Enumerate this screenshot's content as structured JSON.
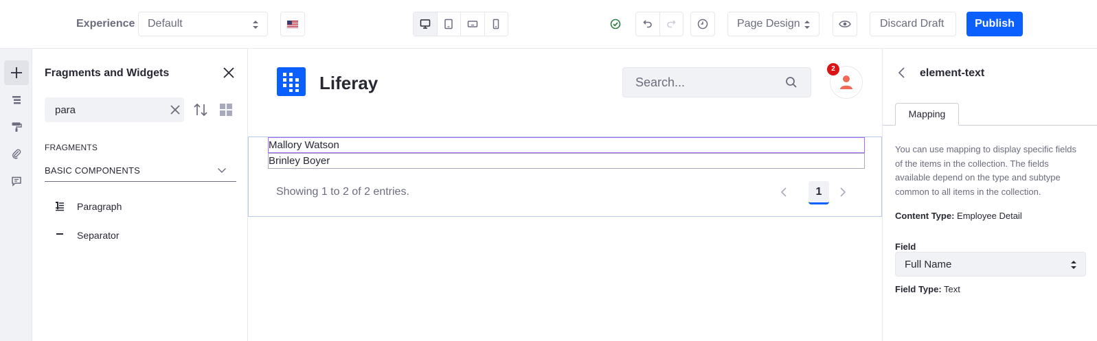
{
  "topbar": {
    "experience_label": "Experience",
    "experience_value": "Default",
    "language_flag": "us-flag-icon",
    "devices": [
      "desktop-icon",
      "tablet-icon",
      "landscape-phone-icon",
      "portrait-phone-icon"
    ],
    "view_mode": "Page Design",
    "discard_label": "Discard Draft",
    "publish_label": "Publish",
    "colors": {
      "primary": "#0b5fff",
      "success": "#287d3c"
    }
  },
  "rail": {
    "items": [
      "plus-icon",
      "page-structure-icon",
      "paint-roller-icon",
      "paperclip-icon",
      "comment-icon"
    ]
  },
  "left_panel": {
    "title": "Fragments and Widgets",
    "search_value": "para",
    "section_label": "FRAGMENTS",
    "group_label": "BASIC COMPONENTS",
    "items": [
      {
        "label": "Paragraph",
        "icon": "paragraph-icon"
      },
      {
        "label": "Separator",
        "icon": "separator-icon"
      }
    ]
  },
  "canvas": {
    "site_name": "Liferay",
    "search_placeholder": "Search...",
    "notification_count": "2",
    "rows": [
      "Mallory Watson",
      "Brinley Boyer"
    ],
    "entries_text": "Showing 1 to 2 of 2 entries.",
    "current_page": "1"
  },
  "right_panel": {
    "title": "element-text",
    "tab_label": "Mapping",
    "description": "You can use mapping to display specific fields of the items in the collection. The fields available depend on the type and subtype common to all items in the collection.",
    "content_type_label": "Content Type:",
    "content_type_value": "Employee Detail",
    "field_label": "Field",
    "field_value": "Full Name",
    "field_type_label": "Field Type:",
    "field_type_value": "Text"
  }
}
